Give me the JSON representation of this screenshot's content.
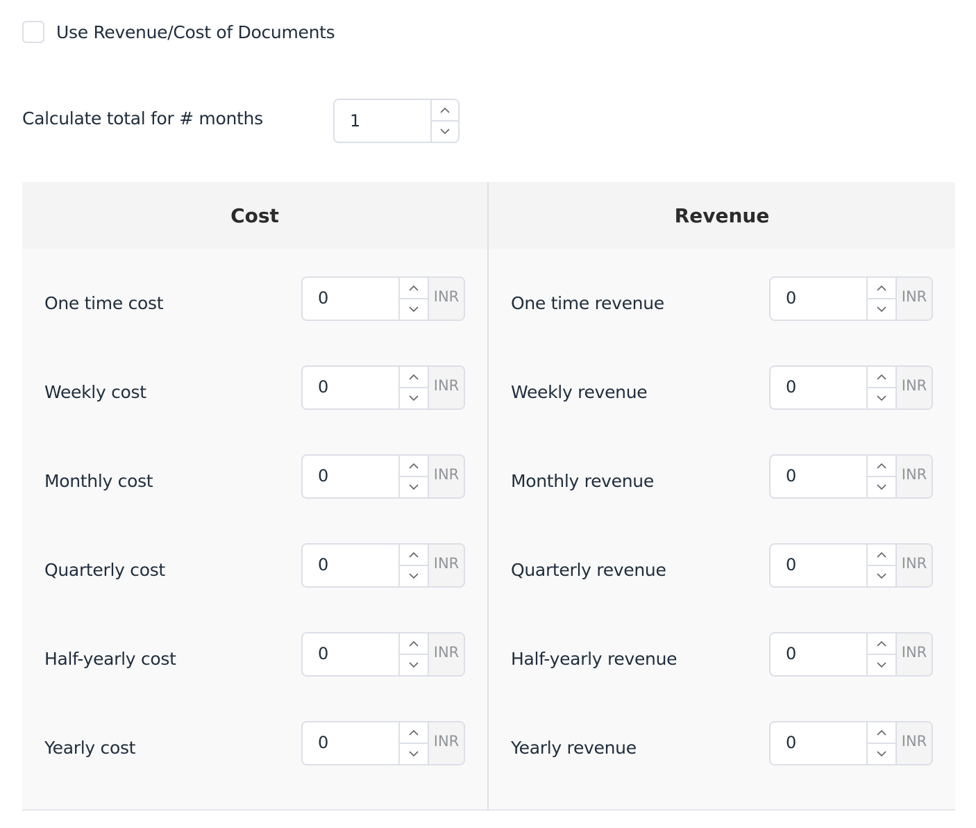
{
  "use_documents": {
    "label": "Use Revenue/Cost of Documents",
    "checked": false
  },
  "months": {
    "label": "Calculate total for # months",
    "value": "1"
  },
  "cost": {
    "title": "Cost",
    "rows": [
      {
        "label": "One time cost",
        "value": "0",
        "unit": "INR"
      },
      {
        "label": "Weekly cost",
        "value": "0",
        "unit": "INR"
      },
      {
        "label": "Monthly cost",
        "value": "0",
        "unit": "INR"
      },
      {
        "label": "Quarterly cost",
        "value": "0",
        "unit": "INR"
      },
      {
        "label": "Half-yearly cost",
        "value": "0",
        "unit": "INR"
      },
      {
        "label": "Yearly cost",
        "value": "0",
        "unit": "INR"
      }
    ]
  },
  "revenue": {
    "title": "Revenue",
    "rows": [
      {
        "label": "One time revenue",
        "value": "0",
        "unit": "INR"
      },
      {
        "label": "Weekly revenue",
        "value": "0",
        "unit": "INR"
      },
      {
        "label": "Monthly revenue",
        "value": "0",
        "unit": "INR"
      },
      {
        "label": "Quarterly revenue",
        "value": "0",
        "unit": "INR"
      },
      {
        "label": "Half-yearly revenue",
        "value": "0",
        "unit": "INR"
      },
      {
        "label": "Yearly revenue",
        "value": "0",
        "unit": "INR"
      }
    ]
  }
}
